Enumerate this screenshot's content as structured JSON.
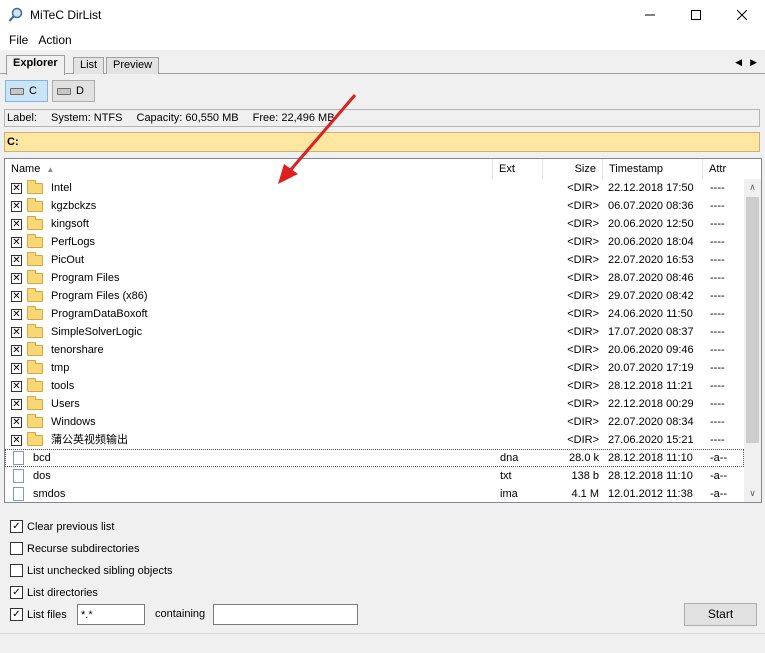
{
  "window": {
    "title": "MiTeC DirList",
    "icon": "magnifier-icon"
  },
  "menu": [
    "File",
    "Action"
  ],
  "tabs": [
    "Explorer",
    "List",
    "Preview"
  ],
  "drives": [
    "C",
    "D"
  ],
  "info": {
    "label": "Label:",
    "system": "System: NTFS",
    "capacity": "Capacity: 60,550 MB",
    "free": "Free: 22,496 MB"
  },
  "path": "C:",
  "columns": {
    "name": "Name",
    "ext": "Ext",
    "size": "Size",
    "timestamp": "Timestamp",
    "attr": "Attr"
  },
  "rows": [
    {
      "type": "folder",
      "checked": true,
      "name": "Intel",
      "ext": "",
      "size": "<DIR>",
      "time": "22.12.2018 17:50",
      "attr": "----"
    },
    {
      "type": "folder",
      "checked": true,
      "name": "kgzbckzs",
      "ext": "",
      "size": "<DIR>",
      "time": "06.07.2020 08:36",
      "attr": "----"
    },
    {
      "type": "folder",
      "checked": true,
      "name": "kingsoft",
      "ext": "",
      "size": "<DIR>",
      "time": "20.06.2020 12:50",
      "attr": "----"
    },
    {
      "type": "folder",
      "checked": true,
      "name": "PerfLogs",
      "ext": "",
      "size": "<DIR>",
      "time": "20.06.2020 18:04",
      "attr": "----"
    },
    {
      "type": "folder",
      "checked": true,
      "name": "PicOut",
      "ext": "",
      "size": "<DIR>",
      "time": "22.07.2020 16:53",
      "attr": "----"
    },
    {
      "type": "folder",
      "checked": true,
      "name": "Program Files",
      "ext": "",
      "size": "<DIR>",
      "time": "28.07.2020 08:46",
      "attr": "----"
    },
    {
      "type": "folder",
      "checked": true,
      "name": "Program Files (x86)",
      "ext": "",
      "size": "<DIR>",
      "time": "29.07.2020 08:42",
      "attr": "----"
    },
    {
      "type": "folder",
      "checked": true,
      "name": "ProgramDataBoxoft",
      "ext": "",
      "size": "<DIR>",
      "time": "24.06.2020 11:50",
      "attr": "----"
    },
    {
      "type": "folder",
      "checked": true,
      "name": "SimpleSolverLogic",
      "ext": "",
      "size": "<DIR>",
      "time": "17.07.2020 08:37",
      "attr": "----"
    },
    {
      "type": "folder",
      "checked": true,
      "name": "tenorshare",
      "ext": "",
      "size": "<DIR>",
      "time": "20.06.2020 09:46",
      "attr": "----"
    },
    {
      "type": "folder",
      "checked": true,
      "name": "tmp",
      "ext": "",
      "size": "<DIR>",
      "time": "20.07.2020 17:19",
      "attr": "----"
    },
    {
      "type": "folder",
      "checked": true,
      "name": "tools",
      "ext": "",
      "size": "<DIR>",
      "time": "28.12.2018 11:21",
      "attr": "----"
    },
    {
      "type": "folder",
      "checked": true,
      "name": "Users",
      "ext": "",
      "size": "<DIR>",
      "time": "22.12.2018 00:29",
      "attr": "----"
    },
    {
      "type": "folder",
      "checked": true,
      "name": "Windows",
      "ext": "",
      "size": "<DIR>",
      "time": "22.07.2020 08:34",
      "attr": "----"
    },
    {
      "type": "folder",
      "checked": true,
      "name": "蒲公英视频输出",
      "ext": "",
      "size": "<DIR>",
      "time": "27.06.2020 15:21",
      "attr": "----"
    },
    {
      "type": "file",
      "checked": false,
      "name": "bcd",
      "ext": "dna",
      "size": "28.0 k",
      "time": "28.12.2018 11:10",
      "attr": "-a--"
    },
    {
      "type": "file",
      "checked": false,
      "name": "dos",
      "ext": "txt",
      "size": "138 b",
      "time": "28.12.2018 11:10",
      "attr": "-a--"
    },
    {
      "type": "file",
      "checked": false,
      "name": "smdos",
      "ext": "ima",
      "size": "4.1 M",
      "time": "12.01.2012 11:38",
      "attr": "-a--"
    }
  ],
  "options": {
    "clear_previous": {
      "label": "Clear previous list",
      "checked": true
    },
    "recurse": {
      "label": "Recurse subdirectories",
      "checked": false
    },
    "unchecked_siblings": {
      "label": "List unchecked sibling objects",
      "checked": false
    },
    "list_dirs": {
      "label": "List directories",
      "checked": true
    },
    "list_files": {
      "label": "List files",
      "checked": true
    },
    "mask": "*.*",
    "containing_label": "containing",
    "containing_value": ""
  },
  "start_label": "Start"
}
